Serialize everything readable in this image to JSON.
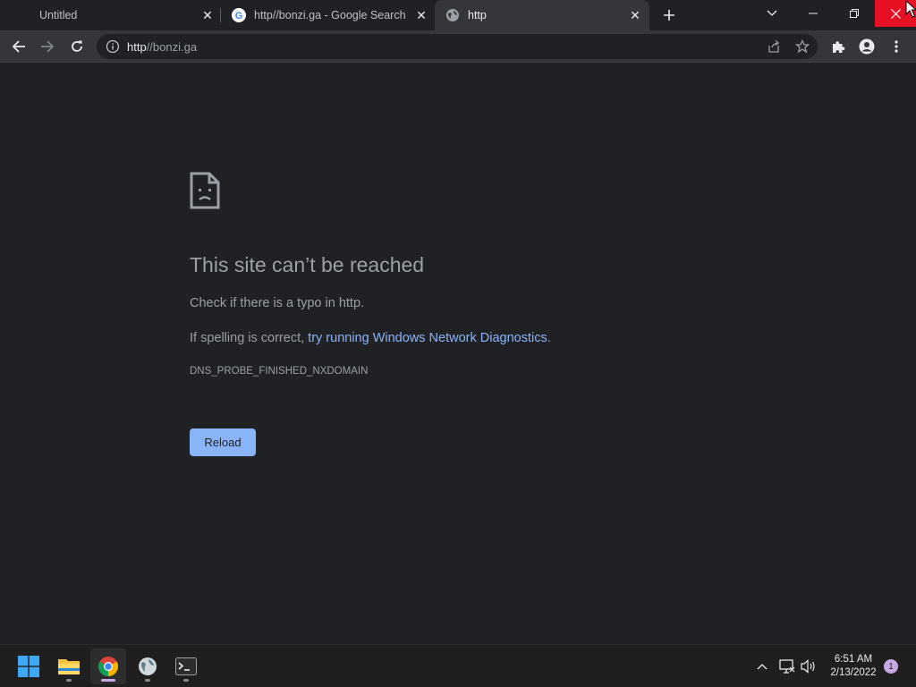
{
  "tabs": [
    {
      "title": "Untitled",
      "favicon": "none",
      "active": false
    },
    {
      "title": "http//bonzi.ga - Google Search",
      "favicon": "google-icon",
      "active": false
    },
    {
      "title": "http",
      "favicon": "globe-icon",
      "active": true
    }
  ],
  "toolbar": {
    "url_host": "http",
    "url_rest": "//bonzi.ga"
  },
  "error_page": {
    "title": "This site can’t be reached",
    "line1": "Check if there is a typo in http.",
    "line2_prefix": "If spelling is correct, ",
    "line2_link": "try running Windows Network Diagnostics",
    "line2_suffix": ".",
    "error_code": "DNS_PROBE_FINISHED_NXDOMAIN",
    "reload_label": "Reload"
  },
  "taskbar": {
    "apps": [
      "start-icon",
      "file-explorer-icon",
      "chrome-icon",
      "globe-app-icon",
      "terminal-icon"
    ],
    "active_app": "chrome-icon",
    "time": "6:51 AM",
    "date": "2/13/2022",
    "notification_count": "1"
  },
  "colors": {
    "accent": "#8ab4f8",
    "close_button": "#e81123",
    "background": "#202124",
    "toolbar": "#35363a"
  }
}
